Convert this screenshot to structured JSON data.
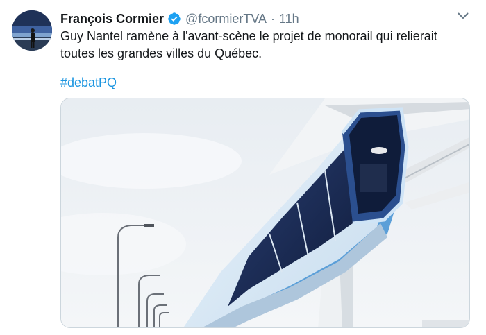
{
  "tweet": {
    "author_name": "François Cormier",
    "handle": "@fcormierTVA",
    "separator": "·",
    "time": "11h",
    "text_line1": "Guy Nantel ramène à l'avant-scène le projet de monorail qui relierait",
    "text_line2": "toutes les grandes villes du Québec.",
    "hashtag": "#debatPQ"
  },
  "icons": {
    "verified": "verified-badge-icon",
    "menu": "chevron-down-icon"
  },
  "colors": {
    "link": "#1b95e0",
    "secondary_text": "#657786",
    "verified": "#1da1f2",
    "border": "#ccd6dd"
  }
}
